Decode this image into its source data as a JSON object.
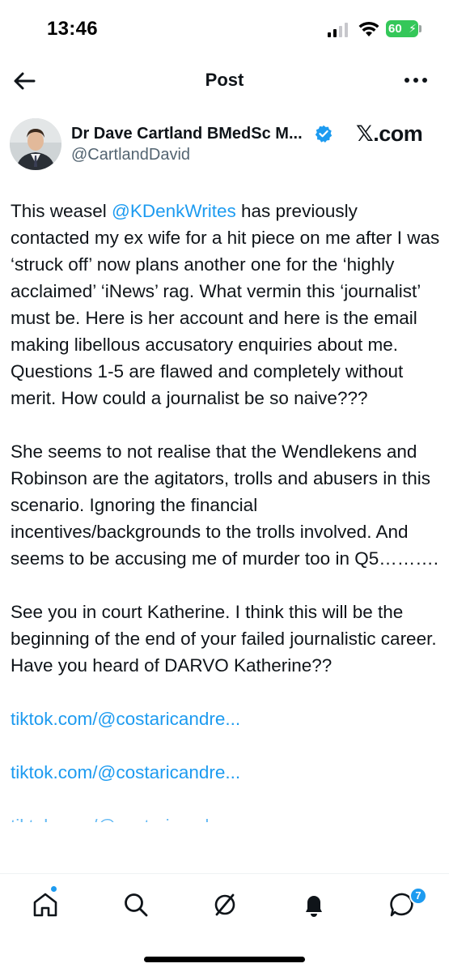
{
  "status_bar": {
    "time": "13:46",
    "battery": "60"
  },
  "header": {
    "title": "Post"
  },
  "author": {
    "display_name": "Dr Dave Cartland BMedSc M...",
    "handle": "@CartlandDavid",
    "source": "𝕏.com"
  },
  "post": {
    "p1_prefix": "This weasel ",
    "p1_mention": "@KDenkWrites",
    "p1_suffix": " has previously contacted my ex wife for a hit piece on me after I was ‘struck off’ now plans another one for the ‘highly acclaimed’ ‘iNews’ rag. What vermin this ‘journalist’ must be. Here is her account and here is the email making libellous accusatory enquiries about me. Questions 1-5 are flawed and completely without merit. How could a journalist be so naive???",
    "p2": "She seems to not realise that the Wendlekens and Robinson are the agitators, trolls and abusers in this scenario. Ignoring the financial incentives/backgrounds to the trolls involved. And seems to be accusing me of murder too in Q5……….",
    "p3": "See you in court Katherine. I think this will be the beginning of the end of your failed journalistic career. Have you heard of DARVO Katherine??",
    "links": [
      "tiktok.com/@costaricandre...",
      "tiktok.com/@costaricandre...",
      "tiktok.com/@costaricandre..."
    ]
  },
  "bottom_nav": {
    "items": [
      "home-icon",
      "search-icon",
      "grok-icon",
      "notifications-icon",
      "messages-icon"
    ],
    "messages_badge": "7"
  },
  "colors": {
    "accent": "#1d9bf0",
    "text": "#0f1419",
    "secondary": "#536471",
    "battery": "#34c759"
  }
}
